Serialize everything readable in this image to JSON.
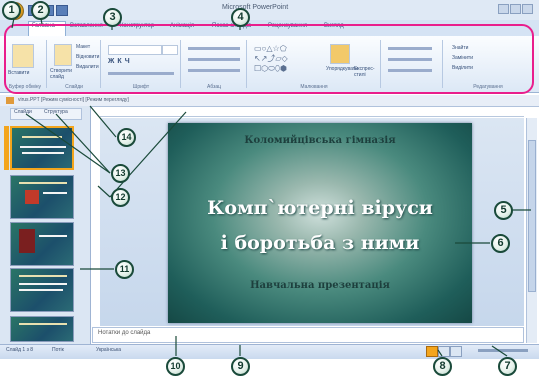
{
  "window": {
    "title": "Microsoft PowerPoint"
  },
  "ribbon": {
    "tabs": [
      "Головна",
      "Вставлення",
      "Конструктор",
      "Анімація",
      "Показ слайдів",
      "Рецензування",
      "Вигляд"
    ],
    "groups": [
      "Буфер обміну",
      "Слайди",
      "Шрифт",
      "Абзац",
      "Малювання",
      "Редагування"
    ],
    "clipboard_button": "Вставити",
    "new_slide_button": "Створити слайд",
    "layout_label": "Макет",
    "reset_label": "Відновити",
    "delete_label": "Видалити",
    "arrange_button": "Упорядкувати",
    "quick_styles_button": "Експрес-стилі",
    "find_label": "Знайти",
    "replace_label": "Замінити",
    "select_label": "Виділити"
  },
  "document": {
    "title": "virus.PPT [Режим сумісності] [Режим перегляду]"
  },
  "slide_pane": {
    "tabs": [
      "Слайди",
      "Структура"
    ]
  },
  "slide": {
    "header": "Коломийцівська гімназія",
    "title_line1": "Комп`ютерні віруси",
    "title_line2": "і боротьба з ними",
    "subtitle": "Навчальна презентація"
  },
  "notes": {
    "placeholder": "Нотатки до слайда"
  },
  "status": {
    "slide_counter": "Слайд 1 з 8",
    "theme": "Потік",
    "language": "Українська"
  },
  "callouts": [
    "1",
    "2",
    "3",
    "4",
    "5",
    "6",
    "7",
    "8",
    "9",
    "10",
    "11",
    "12",
    "13",
    "14"
  ],
  "colors": {
    "accent_pink": "#e91e8c",
    "callout_border": "#1a4a3a",
    "slide_bg": "#1f5e5a"
  }
}
